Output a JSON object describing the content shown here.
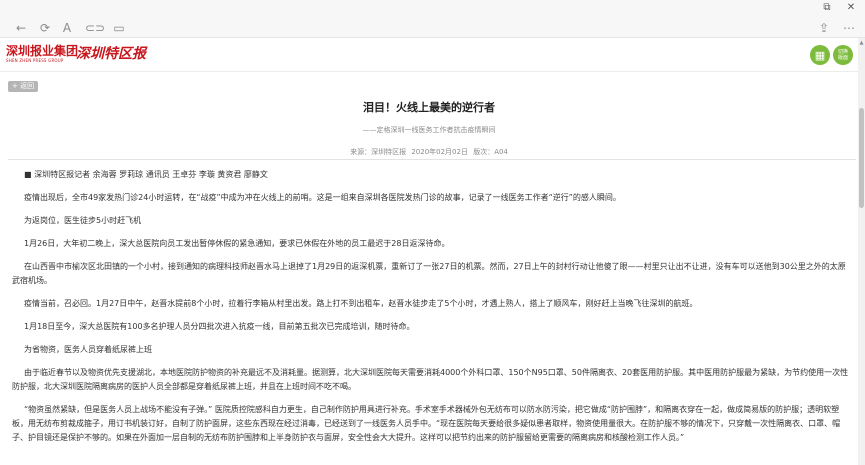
{
  "browser": {
    "toolbar": {
      "back_icon": "arrow-left",
      "reload_icon": "reload",
      "reader_icon": "A",
      "link_icon": "link",
      "tab_icon": "tab"
    },
    "right": {
      "share_icon": "share",
      "more_icon": "more"
    }
  },
  "site": {
    "group_name": "深圳报业集团",
    "group_name_en": "SHEN ZHEN PRESS GROUP",
    "paper_name": "深圳特区报",
    "calendar_icon": "calendar",
    "switch_label_line1": "切换",
    "switch_label_line2": "版面"
  },
  "article": {
    "back_label": "+ 返回",
    "title": "泪目！火线上最美的逆行者",
    "subtitle": "——定格深圳一线医务工作者抗击疫情瞬间",
    "meta": "来源：深圳特区报   2020年02月02日   版次：A04",
    "paragraphs": [
      "■ 深圳特区报记者 余海蓉 罗莉琼 通讯员 王卓芬 李璇 黄资君 廖静文",
      "疫情出现后，全市49家发热门诊24小时运转，在“战疫”中成为冲在火线上的前哨。这是一组来自深圳各医院发热门诊的故事，记录了一线医务工作者“逆行”的感人瞬间。",
      "为返岗位，医生徒步5小时赶飞机",
      "1月26日，大年初二晚上，深大总医院向员工发出暂停休假的紧急通知，要求已休假在外地的员工最迟于28日返深待命。",
      "在山西晋中市榆次区北田镇的一个小村，接到通知的病理科技师赵晋水马上退掉了1月29日的返深机票，重新订了一张27日的机票。然而，27日上午的封村行动让他傻了眼——村里只让出不让进，没有车可以送他到30公里之外的太原武宿机场。",
      "疫情当前，召必回。1月27日中午，赵晋水提前8个小时，拉着行李箱从村里出发。路上打不到出租车，赵晋水徒步走了5个小时，才遇上熟人，搭上了顺风车，刚好赶上当晚飞往深圳的航班。",
      "1月18日至今，深大总医院有100多名护理人员分四批次进入抗疫一线，目前第五批次已完成培训，随时待命。",
      "为省物资，医务人员穿着纸尿裤上班",
      "由于临近春节以及物资优先支援湖北，本地医院防护物资的补充最远不及消耗量。据测算，北大深圳医院每天需要消耗4000个外科口罩、150个N95口罩、50件隔离衣、20套医用防护服。其中医用防护服最为紧缺，为节约使用一次性防护服，北大深圳医院隔离病房的医护人员全部都是穿着纸尿裤上班，并且在上班时间不吃不喝。",
      "“物资虽然紧缺，但是医务人员上战场不能没有子弹。” 医院质控院感科自力更生，自己制作防护用具进行补充。手术室手术器械外包无纺布可以防水防污染，把它做成“防护围脖”，和隔离衣穿在一起，做成简易版的防护服；透明软塑板，用无纺布剪裁成箍子，用订书机装订好，自制了防护面屏，这些东西现在经过消毒，已经送到了一线医务人员手中。“现在医院每天要给很多疑似患者取样，物资使用量很大。在防护服不够的情况下，只穿戴一次性隔离衣、口罩、帽子、护目镜还是保护不够的。如果在外面加一层自制的无纺布防护围脖和上半身防护衣与面屏，安全性会大大提升。这样可以把节约出来的防护服留给更需要的隔离病房和核酸检测工作人员。”"
    ]
  }
}
